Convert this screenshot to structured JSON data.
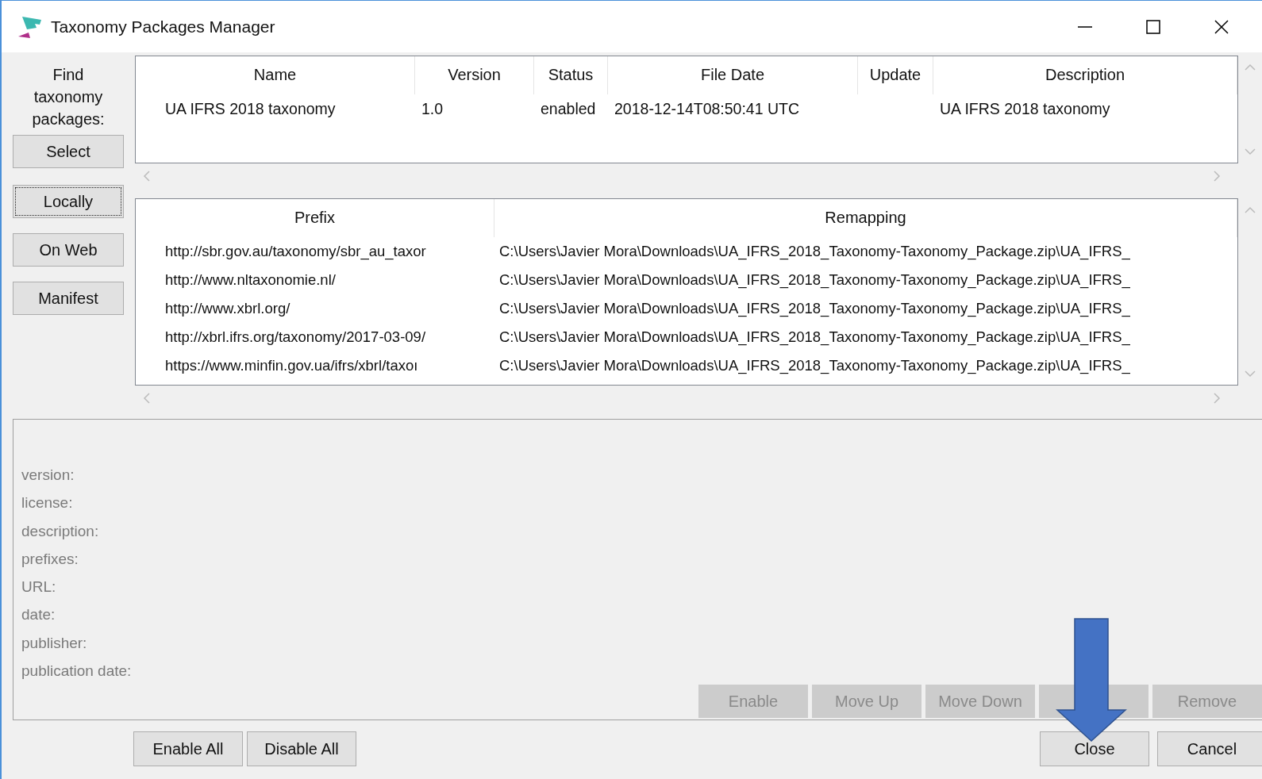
{
  "window": {
    "title": "Taxonomy Packages Manager"
  },
  "find_label": "Find taxonomy packages:",
  "find_buttons": [
    {
      "label": "Select",
      "focused": false
    },
    {
      "label": "Locally",
      "focused": true
    },
    {
      "label": "On Web",
      "focused": false
    },
    {
      "label": "Manifest",
      "focused": false
    }
  ],
  "packages_table": {
    "columns": [
      "Name",
      "Version",
      "Status",
      "File Date",
      "Update",
      "Description"
    ],
    "rows": [
      [
        "UA IFRS 2018 taxonomy",
        "1.0",
        "enabled",
        "2018-12-14T08:50:41 UTC",
        "",
        "UA IFRS 2018 taxonomy"
      ]
    ]
  },
  "mappings_table": {
    "columns": [
      "Prefix",
      "Remapping"
    ],
    "rows": [
      [
        "http://sbr.gov.au/taxonomy/sbr_au_taxor",
        "C:\\Users\\Javier Mora\\Downloads\\UA_IFRS_2018_Taxonomy-Taxonomy_Package.zip\\UA_IFRS_"
      ],
      [
        "http://www.nltaxonomie.nl/",
        "C:\\Users\\Javier Mora\\Downloads\\UA_IFRS_2018_Taxonomy-Taxonomy_Package.zip\\UA_IFRS_"
      ],
      [
        "http://www.xbrl.org/",
        "C:\\Users\\Javier Mora\\Downloads\\UA_IFRS_2018_Taxonomy-Taxonomy_Package.zip\\UA_IFRS_"
      ],
      [
        "http://xbrl.ifrs.org/taxonomy/2017-03-09/",
        "C:\\Users\\Javier Mora\\Downloads\\UA_IFRS_2018_Taxonomy-Taxonomy_Package.zip\\UA_IFRS_"
      ],
      [
        "https://www.minfin.gov.ua/ifrs/xbrl/taxoı",
        "C:\\Users\\Javier Mora\\Downloads\\UA_IFRS_2018_Taxonomy-Taxonomy_Package.zip\\UA_IFRS_"
      ]
    ]
  },
  "info_labels": [
    "version:",
    "license:",
    "description:",
    "prefixes:",
    "URL:",
    "date:",
    "publisher:",
    "publication date:"
  ],
  "action_buttons": [
    {
      "label": "Enable",
      "disabled": true
    },
    {
      "label": "Move Up",
      "disabled": true
    },
    {
      "label": "Move Down",
      "disabled": true
    },
    {
      "disabled": true
    },
    {
      "label": "Remove",
      "disabled": true
    }
  ],
  "footer_left_buttons": [
    {
      "label": "Enable All",
      "disabled": false
    },
    {
      "label": "Disable All",
      "disabled": false
    }
  ],
  "footer_right_buttons": [
    {
      "label": "Close",
      "disabled": false
    },
    {
      "label": "Cancel",
      "disabled": false
    }
  ]
}
